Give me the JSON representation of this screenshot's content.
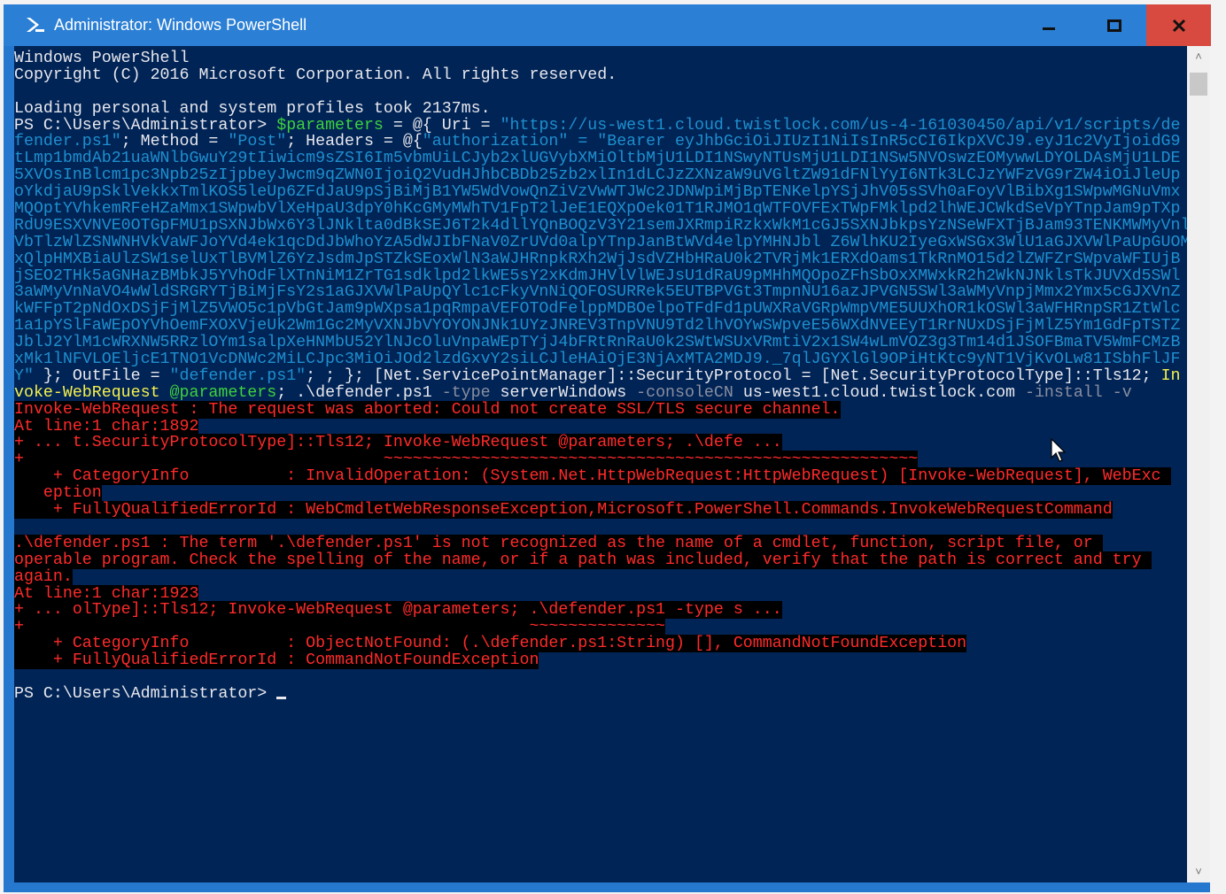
{
  "window": {
    "title": "Administrator: Windows PowerShell",
    "minimize": "–",
    "maximize": "□",
    "close": "✕"
  },
  "colors": {
    "console_bg": "#012456",
    "titlebar": "#2b7fd4",
    "error_fg": "#ff2a2a",
    "string": "#1e8fcf",
    "variable": "#3ed13e"
  },
  "console": {
    "lines": [
      [
        [
          "def",
          "Windows PowerShell"
        ]
      ],
      [
        [
          "def",
          "Copyright (C) 2016 Microsoft Corporation. All rights reserved."
        ]
      ],
      [],
      [
        [
          "def",
          "Loading personal and system profiles took 2137ms."
        ]
      ],
      [
        [
          "def",
          "PS C:\\Users\\Administrator> "
        ],
        [
          "var",
          "$parameters"
        ],
        [
          "def",
          " = @{ Uri = "
        ],
        [
          "str",
          "\"https://us-west1.cloud.twistlock.com/us-4-161030450/api/v1/scripts/de"
        ]
      ],
      [
        [
          "str",
          "fender.ps1\""
        ],
        [
          "def",
          "; Method = "
        ],
        [
          "str",
          "\"Post\""
        ],
        [
          "def",
          "; Headers = @{"
        ],
        [
          "str",
          "\"authorization\" = \"Bearer eyJhbGciOiJIUzI1NiIsInR5cCI6IkpXVCJ9.eyJ1c2VyIjoidG9"
        ]
      ],
      [
        [
          "str",
          "tLmp1bmdAb21uaWNlbGwuY29tIiwicm9sZSI6Im5vbmUiLCJyb2xlUGVybXMiOltbMjU1LDI1NSwyNTUsMjU1LDI1NSw5NVOswzEOMywwLDYOLDAsMjU1LDE"
        ]
      ],
      [
        [
          "str",
          "5XVOsInBlcm1pc3Npb25zIjpbeyJwcm9qZWN0IjoiQ2VudHJhbCBDb25zb2xlIn1dLCJzZXNzaW9uVGltZW91dFNlYyI6NTk3LCJzYWFzVG9rZW4iOiJleUp"
        ]
      ],
      [
        [
          "str",
          "oYkdjaU9pSklVekkxTmlKOS5leUp6ZFdJaU9pSjBiMjB1YW5WdVowQnZiVzVwWTJWc2JDNWpiMjBpTENKelpYSjJhV05sSVh0aFoyVlBibXg1SWpwMGNuVmx"
        ]
      ],
      [
        [
          "str",
          "MQOptYVhkemRFeHZaMmx1SWpwbVlXeHpaU3dpY0hKcGMyMWhTV1FpT2lJeE1EQXpOek01T1RJMO1qWTFOVFExTWpFMklpd2lhWEJCWkdSeVpYTnpJam9pTXp"
        ]
      ],
      [
        [
          "str",
          "RdU9ESXVNVE0OTGpFMU1pSXNJbWx6Y3lJNklta0dBkSEJ6T2k4dllYQnBOQzV3Y21semJXRmpiRzkxWkM1cGJ5SXNJbkpsYzNSeWFXTjBJam93TENKMWMyVnl"
        ]
      ],
      [
        [
          "str",
          "VbTlzWlZSNWNHVkVaWFJoYVd4ek1qcDdJbWhoYzA5dWJIbFNaV0ZrUVd0alpYTnpJanBtWVd4elpYMHNJbl Z6WlhKU2IyeGxWSGx3WlU1aGJXVWlPaUpGUOM"
        ]
      ],
      [
        [
          "str",
          "xQlpHMXBiaUlzSW1selUxTlBVMlZ6YzJsdmJpSTZkSEoxWlN3aWJHRnpkRXh2WjJsdVZHbHRaU0k2TVRjMk1ERXdOams1TkRnMO15d2lZWFZrSWpvaWFIUjB"
        ]
      ],
      [
        [
          "str",
          "jSEO2THk5aGNHazBMbkJ5YVhOdFlXTnNiM1ZrTG1sdklpd2lkWE5sY2xKdmJHVlVlWEJsU1dRaU9pMHhMQOpoZFhSbOxXMWxkR2h2WkNJNklsTkJUVXd5SWl"
        ]
      ],
      [
        [
          "str",
          "3aWMyVnNaVO4wWldSRGRYTjBiMjFsY2s1aGJXVWlPaUpQYlc1cFkyVnNiQOFOSURRek5EUTBPVGt3TmpnNU16azJPVGN5SWl3aWMyVnpjMmx2Ymx5cGJXVnZ"
        ]
      ],
      [
        [
          "str",
          "kWFFpT2pNdOxDSjFjMlZ5VWO5c1pVbGtJam9pWXpsa1pqRmpaVEFOTOdFelppMDBOelpoTFdFd1pUWXRaVGRpWmpVME5UUXhOR1kOSWl3aWFHRnpSR1ZtWlc"
        ]
      ],
      [
        [
          "str",
          "1a1pYSlFaWEpOYVhOemFXOXVjeUk2Wm1Gc2MyVXNJbVYOYONJNk1UYzJNREV3TnpVNU9Td2lhVOYwSWpveE56WXdNVEEyT1RrNUxDSjFjMlZ5Ym1GdFpTSTZ"
        ]
      ],
      [
        [
          "str",
          "JblJ2YlM1cWRXNW5RRzlOYm1salpXeHNMbU52YlNJcOluVnpaWEpTYjJ4bFRtRnRaU0k2SWtWSUxVRmtiV2x1SW4wLmVOZ3g3Tm14d1JSOFBmaTV5WmFCMzB"
        ]
      ],
      [
        [
          "str",
          "xMk1lNFVLOEljcE1TNO1VcDNWc2MiLCJpc3MiOiJOd2lzdGxvY2siLCJleHAiOjE3NjAxMTA2MDJ9._7qlJGYXlGl9OPiHtKtc9yNT1VjKvOLw81ISbhFlJF"
        ]
      ],
      [
        [
          "str",
          "Y\""
        ],
        [
          "def",
          " }; OutFile = "
        ],
        [
          "str",
          "\"defender.ps1\""
        ],
        [
          "def",
          "; ; }; [Net.ServicePointManager]::SecurityProtocol = [Net.SecurityProtocolType]::Tls12; "
        ],
        [
          "cmd",
          "In"
        ]
      ],
      [
        [
          "cmd",
          "voke-WebRequest "
        ],
        [
          "var",
          "@parameters"
        ],
        [
          "def",
          "; .\\defender.ps1 "
        ],
        [
          "par",
          "-type"
        ],
        [
          "def",
          " serverWindows "
        ],
        [
          "par",
          "-consoleCN"
        ],
        [
          "def",
          " us-west1.cloud.twistlock.com "
        ],
        [
          "par",
          "-install -v"
        ]
      ],
      [
        [
          "err",
          "Invoke-WebRequest : The request was aborted: Could not create SSL/TLS secure channel."
        ]
      ],
      [
        [
          "err",
          "At line:1 char:1892"
        ]
      ],
      [
        [
          "err",
          "+ ... t.SecurityProtocolType]::Tls12; Invoke-WebRequest @parameters; .\\defe ..."
        ]
      ],
      [
        [
          "err",
          "+                                     ~~~~~~~~~~~~~~~~~~~~~~~~~~~~~~~~~~~~~~~~~~~~~~~~~~~~~~~"
        ]
      ],
      [
        [
          "err",
          "    + CategoryInfo          : InvalidOperation: (System.Net.HttpWebRequest:HttpWebRequest) [Invoke-WebRequest], WebExc "
        ]
      ],
      [
        [
          "err",
          "   eption"
        ]
      ],
      [
        [
          "err",
          "    + FullyQualifiedErrorId : WebCmdletWebResponseException,Microsoft.PowerShell.Commands.InvokeWebRequestCommand"
        ]
      ],
      [],
      [
        [
          "err",
          ".\\defender.ps1 : The term '.\\defender.ps1' is not recognized as the name of a cmdlet, function, script file, or "
        ]
      ],
      [
        [
          "err",
          "operable program. Check the spelling of the name, or if a path was included, verify that the path is correct and try "
        ]
      ],
      [
        [
          "err",
          "again."
        ]
      ],
      [
        [
          "err",
          "At line:1 char:1923"
        ]
      ],
      [
        [
          "err",
          "+ ... olType]::Tls12; Invoke-WebRequest @parameters; .\\defender.ps1 -type s ..."
        ]
      ],
      [
        [
          "err",
          "+                                                    ~~~~~~~~~~~~~~"
        ]
      ],
      [
        [
          "err",
          "    + CategoryInfo          : ObjectNotFound: (.\\defender.ps1:String) [], CommandNotFoundException"
        ]
      ],
      [
        [
          "err",
          "    + FullyQualifiedErrorId : CommandNotFoundException"
        ]
      ],
      [],
      [
        [
          "def",
          "PS C:\\Users\\Administrator> "
        ]
      ]
    ]
  }
}
